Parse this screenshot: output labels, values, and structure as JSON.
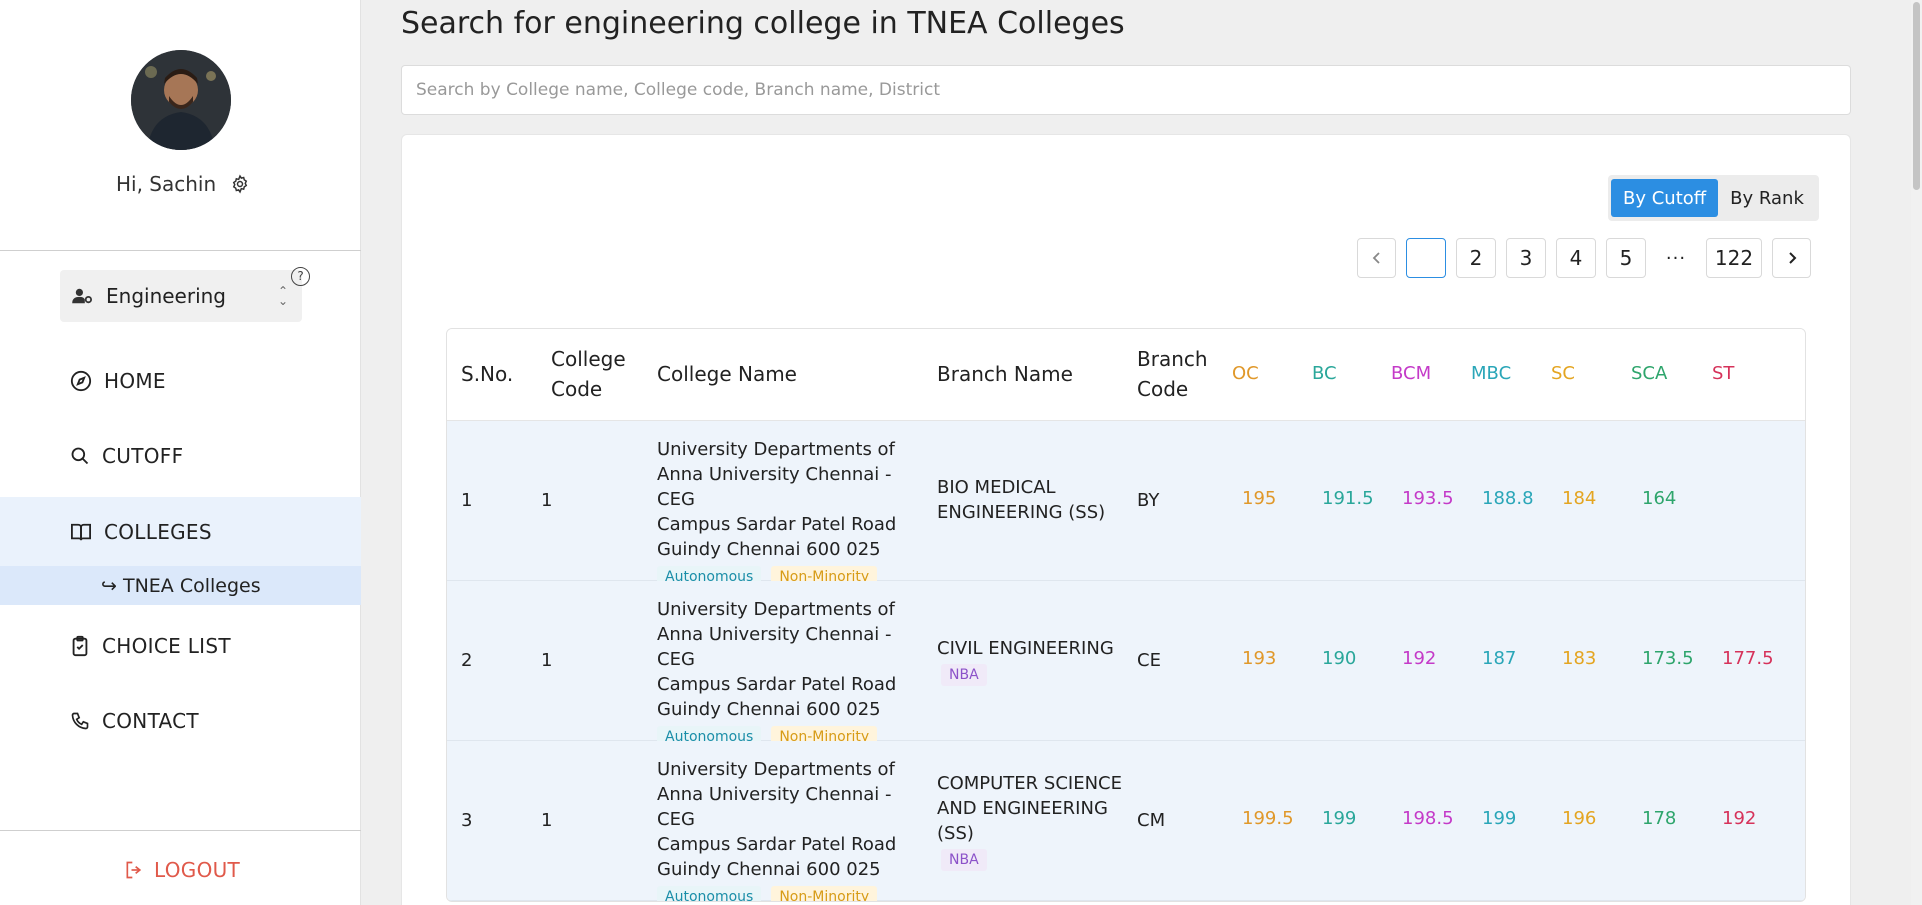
{
  "sidebar": {
    "greeting": "Hi, Sachin",
    "stream_select": "Engineering",
    "nav": {
      "home": "HOME",
      "cutoff": "CUTOFF",
      "colleges": "COLLEGES",
      "tnea": "↪ TNEA Colleges",
      "choice": "CHOICE LIST",
      "contact": "CONTACT"
    },
    "logout": "LOGOUT"
  },
  "main": {
    "title": "Search for engineering college in TNEA Colleges",
    "search_placeholder": "Search by College name, College code, Branch name, District",
    "toggle": {
      "cutoff": "By Cutoff",
      "rank": "By Rank",
      "active": "By Cutoff"
    },
    "pagination": {
      "current": "",
      "pages": [
        "2",
        "3",
        "4",
        "5"
      ],
      "ellipsis": "···",
      "last": "122"
    },
    "table": {
      "headers": {
        "sno": "S.No.",
        "college_code_1": "College",
        "college_code_2": "Code",
        "college_name": "College Name",
        "branch_name": "Branch Name",
        "branch_code_1": "Branch",
        "branch_code_2": "Code",
        "oc": "OC",
        "bc": "BC",
        "bcm": "BCM",
        "mbc": "MBC",
        "sc": "SC",
        "sca": "SCA",
        "st": "ST"
      },
      "rows": [
        {
          "sno": "1",
          "code": "1",
          "college": [
            "University Departments of",
            "Anna University Chennai - CEG",
            "Campus Sardar Patel Road",
            "Guindy Chennai 600 025"
          ],
          "tag1": "Autonomous",
          "tag2": "Non-Minority",
          "branch": [
            "BIO MEDICAL",
            "ENGINEERING (SS)"
          ],
          "nba": "",
          "bcode": "BY",
          "oc": "195",
          "bc": "191.5",
          "bcm": "193.5",
          "mbc": "188.8",
          "sc": "184",
          "sca": "164",
          "st": ""
        },
        {
          "sno": "2",
          "code": "1",
          "college": [
            "University Departments of",
            "Anna University Chennai - CEG",
            "Campus Sardar Patel Road",
            "Guindy Chennai 600 025"
          ],
          "tag1": "Autonomous",
          "tag2": "Non-Minority",
          "branch": [
            "CIVIL ENGINEERING"
          ],
          "nba": "NBA",
          "bcode": "CE",
          "oc": "193",
          "bc": "190",
          "bcm": "192",
          "mbc": "187",
          "sc": "183",
          "sca": "173.5",
          "st": "177.5"
        },
        {
          "sno": "3",
          "code": "1",
          "college": [
            "University Departments of",
            "Anna University Chennai - CEG",
            "Campus Sardar Patel Road",
            "Guindy Chennai 600 025"
          ],
          "tag1": "Autonomous",
          "tag2": "Non-Minority",
          "branch": [
            "COMPUTER SCIENCE",
            "AND ENGINEERING",
            "(SS)"
          ],
          "nba": "NBA",
          "bcode": "CM",
          "oc": "199.5",
          "bc": "199",
          "bcm": "198.5",
          "mbc": "199",
          "sc": "196",
          "sca": "178",
          "st": "192"
        }
      ]
    }
  },
  "colors": {
    "accent": "#2c8ee2",
    "logout": "#e0594a",
    "oc": "#e0982a",
    "bc": "#2aa79a",
    "bcm": "#c43ac8",
    "mbc": "#2aa6b8",
    "sc": "#e4a521",
    "sca": "#2ea56c",
    "st": "#d6325a"
  }
}
